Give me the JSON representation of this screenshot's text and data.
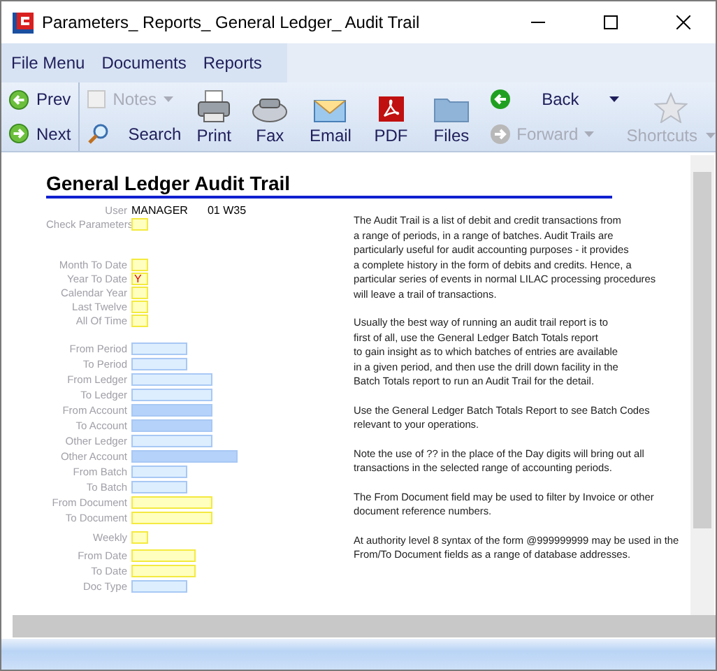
{
  "window": {
    "title": "Parameters_ Reports_ General Ledger_ Audit Trail"
  },
  "menu": [
    "File Menu",
    "Documents",
    "Reports"
  ],
  "nav": [
    {
      "label": "Prev",
      "kind": "prev"
    },
    {
      "label": "Next",
      "kind": "next"
    }
  ],
  "tools": [
    {
      "label": "Notes",
      "kind": "notes",
      "disabled": true,
      "dropdown": true
    },
    {
      "label": "Search",
      "kind": "search",
      "disabled": false,
      "dropdown": false
    }
  ],
  "big_tools": [
    {
      "label": "Print",
      "kind": "print"
    },
    {
      "label": "Fax",
      "kind": "fax"
    },
    {
      "label": "Email",
      "kind": "email"
    },
    {
      "label": "PDF",
      "kind": "pdf"
    },
    {
      "label": "Files",
      "kind": "files"
    }
  ],
  "history": [
    {
      "label": "Back",
      "kind": "back",
      "disabled": false
    },
    {
      "label": "Forward",
      "kind": "forward",
      "disabled": true
    }
  ],
  "shortcuts": {
    "label": "Shortcuts",
    "disabled": true
  },
  "form": {
    "title": "General Ledger Audit Trail",
    "user": {
      "label": "User",
      "name": "MANAGER",
      "period": "01 W35"
    },
    "groups": [
      [
        {
          "label": "Check Parameters",
          "kind": "check",
          "color": "#ffffc0"
        }
      ],
      [
        {
          "label": "Month To Date",
          "kind": "check",
          "color": "#ffffc0"
        },
        {
          "label": "Year To Date",
          "kind": "check",
          "color": "#ffffc0",
          "value": "Y"
        },
        {
          "label": "Calendar Year",
          "kind": "check",
          "color": "#ffffc0"
        },
        {
          "label": "Last Twelve",
          "kind": "check",
          "color": "#ffffc0"
        },
        {
          "label": "All Of Time",
          "kind": "check",
          "color": "#ffffc0"
        }
      ],
      [
        {
          "label": "From Period",
          "kind": "short",
          "color": "#ddeeff"
        },
        {
          "label": "To Period",
          "kind": "short",
          "color": "#ddeeff"
        },
        {
          "label": "From Ledger",
          "kind": "long",
          "color": "#ddeeff"
        },
        {
          "label": "To Ledger",
          "kind": "long",
          "color": "#ddeeff"
        },
        {
          "label": "From Account",
          "kind": "long",
          "color": "#b4d2fa"
        },
        {
          "label": "To Account",
          "kind": "long",
          "color": "#b4d2fa"
        },
        {
          "label": "Other Ledger",
          "kind": "long",
          "color": "#ddeeff"
        },
        {
          "label": "Other Account",
          "kind": "wide",
          "color": "#b4d2fa"
        },
        {
          "label": "From Batch",
          "kind": "short",
          "color": "#ddeeff"
        },
        {
          "label": "To Batch",
          "kind": "short",
          "color": "#ddeeff"
        },
        {
          "label": "From Document",
          "kind": "long",
          "color": "#ffffc0"
        },
        {
          "label": "To Document",
          "kind": "long",
          "color": "#ffffc0"
        }
      ],
      [
        {
          "label": "Weekly",
          "kind": "check",
          "color": "#ffffc0"
        }
      ],
      [
        {
          "label": "From Date",
          "kind": "mid",
          "color": "#ffffc0"
        },
        {
          "label": "To Date",
          "kind": "mid",
          "color": "#ffffc0"
        },
        {
          "label": "Doc Type",
          "kind": "short",
          "color": "#ddeeff"
        }
      ]
    ]
  },
  "help": [
    [
      "The Audit Trail is a list of debit and credit transactions from",
      "a range of periods, in a range of batches. Audit Trails are",
      "particularly useful for audit accounting purposes - it provides",
      "a complete history in the form of debits and credits. Hence, a",
      "particular series of events in normal LILAC processing procedures",
      "will leave a trail of transactions."
    ],
    [
      "Usually the best way of running an audit trail report is to",
      "first of all, use the General Ledger Batch Totals report",
      "to gain insight as to which batches of entries are available",
      "in a given period, and then use the drill down facility in the",
      "Batch Totals report to run an Audit Trail for the detail."
    ],
    [
      "Use the General Ledger Batch Totals Report to see Batch Codes",
      "relevant to your operations."
    ],
    [
      "Note the use of ?? in the place of the Day digits will bring out all",
      "transactions in the selected range of accounting periods."
    ],
    [
      "The From Document field may be used to filter by Invoice or other",
      "document reference numbers."
    ],
    [
      "At authority level 8 syntax of the form @999999999 may be used in the",
      "From/To Document fields as a range of database addresses."
    ]
  ]
}
